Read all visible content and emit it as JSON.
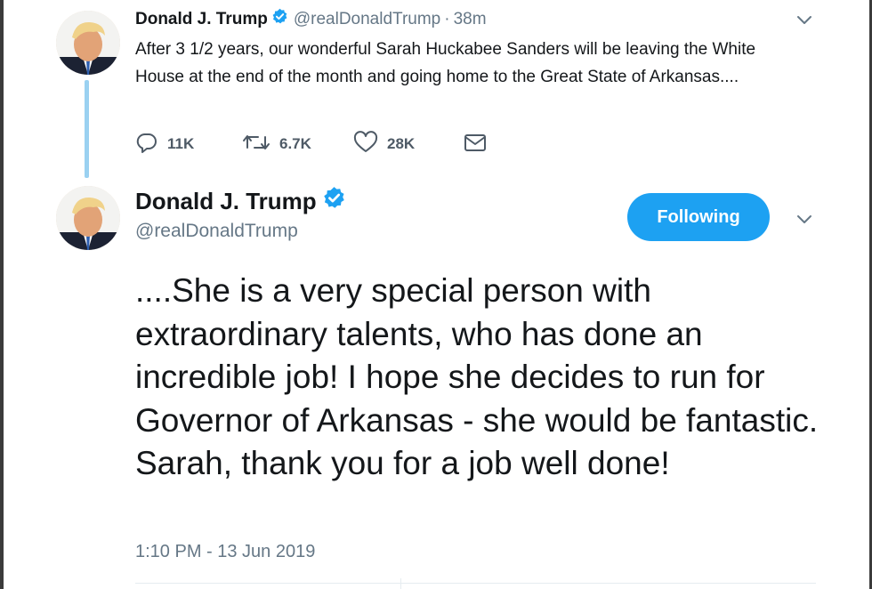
{
  "parent_tweet": {
    "name": "Donald J. Trump",
    "handle": "@realDonaldTrump",
    "separator": "·",
    "time": "38m",
    "text": "After 3 1/2 years, our wonderful Sarah Huckabee Sanders will be leaving the White House at the end of the month and going home to the Great State of Arkansas....",
    "actions": {
      "reply_count": "11K",
      "retweet_count": "6.7K",
      "like_count": "28K"
    }
  },
  "main_tweet": {
    "name": "Donald J. Trump",
    "handle": "@realDonaldTrump",
    "follow_label": "Following",
    "text": "....She is a very special person with extraordinary talents, who has done an incredible job! I hope she decides to run for Governor of Arkansas - she would be fantastic. Sarah, thank you for a job well done!",
    "timestamp": "1:10 PM - 13 Jun 2019"
  },
  "colors": {
    "accent": "#1da1f2",
    "thread_line": "#9ad1f1",
    "muted_text": "#657786",
    "icon": "#4e5a66"
  },
  "icons": [
    "verified-badge-icon",
    "chevron-down-icon",
    "reply-icon",
    "retweet-icon",
    "like-icon",
    "direct-message-icon"
  ]
}
